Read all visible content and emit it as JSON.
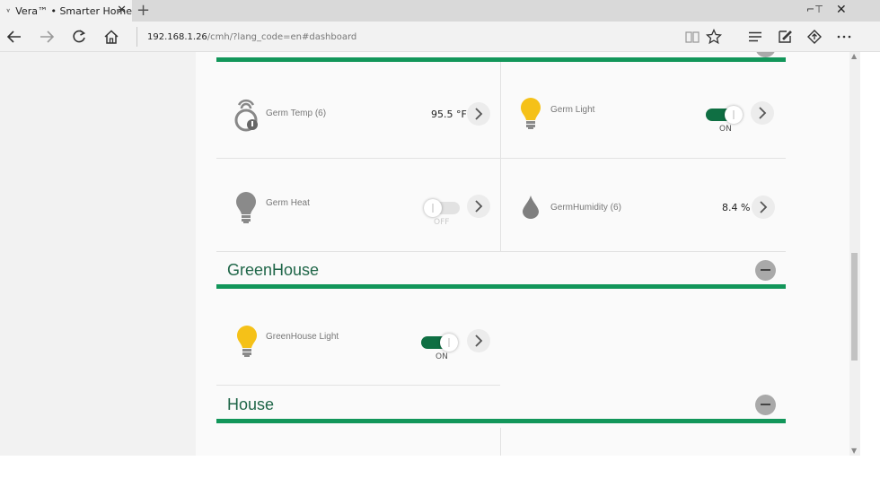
{
  "browser": {
    "tab_title": "Vera™ • Smarter Home",
    "url_host": "192.168.1.26",
    "url_path": "/cmh/?lang_code=en#dashboard"
  },
  "colors": {
    "accent_green": "#12965a",
    "toggle_on": "#0f6f43",
    "bulb_on": "#f5c118",
    "bulb_off": "#8a8a8a",
    "section_title": "#1f6648"
  },
  "devices_top": [
    {
      "name": "Germ Temp (6)",
      "icon": "temperature-sensor-icon",
      "value": "95.5 °F"
    },
    {
      "name": "Germ Light",
      "icon": "lightbulb-on-icon",
      "state": "ON",
      "on": true
    },
    {
      "name": "Germ Heat",
      "icon": "lightbulb-off-icon",
      "state": "OFF",
      "on": false
    },
    {
      "name": "GermHumidity (6)",
      "icon": "humidity-drop-icon",
      "value": "8.4  %"
    }
  ],
  "sections": [
    {
      "title": "GreenHouse",
      "devices": [
        {
          "name": "GreenHouse Light",
          "icon": "lightbulb-on-icon",
          "state": "ON",
          "on": true
        }
      ]
    },
    {
      "title": "House",
      "devices": []
    }
  ]
}
